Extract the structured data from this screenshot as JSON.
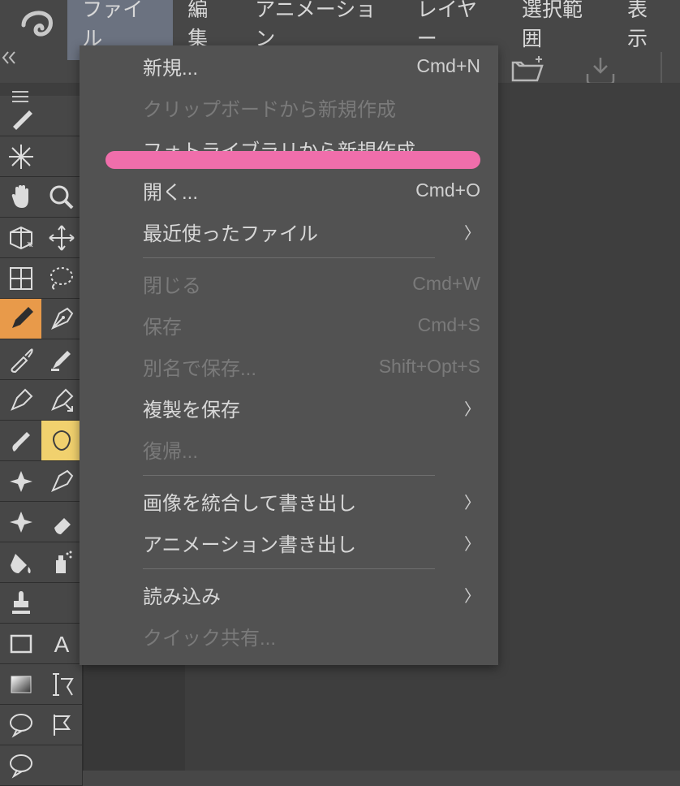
{
  "menubar": {
    "items": [
      "ファイル",
      "編集",
      "アニメーション",
      "レイヤー",
      "選択範囲",
      "表示"
    ]
  },
  "dropdown": {
    "new": {
      "label": "新規...",
      "shortcut": "Cmd+N"
    },
    "clipboard_new": {
      "label": "クリップボードから新規作成"
    },
    "photolib_new": {
      "label": "フォトライブラリから新規作成..."
    },
    "open": {
      "label": "開く...",
      "shortcut": "Cmd+O"
    },
    "recent": {
      "label": "最近使ったファイル"
    },
    "close": {
      "label": "閉じる",
      "shortcut": "Cmd+W"
    },
    "save": {
      "label": "保存",
      "shortcut": "Cmd+S"
    },
    "save_as": {
      "label": "別名で保存...",
      "shortcut": "Shift+Opt+S"
    },
    "save_dup": {
      "label": "複製を保存"
    },
    "revert": {
      "label": "復帰..."
    },
    "export_merged": {
      "label": "画像を統合して書き出し"
    },
    "export_anim": {
      "label": "アニメーション書き出し"
    },
    "import": {
      "label": "読み込み"
    },
    "quick_share": {
      "label": "クイック共有..."
    }
  }
}
